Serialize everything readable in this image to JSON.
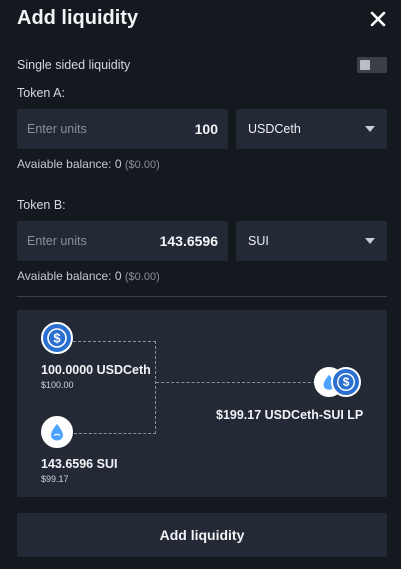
{
  "header": {
    "title": "Add liquidity"
  },
  "single_sided": {
    "label": "Single sided liquidity",
    "enabled": false
  },
  "token_a": {
    "label": "Token A:",
    "placeholder": "Enter units",
    "amount": "100",
    "token": "USDCeth",
    "balance_label": "Avaiable balance: 0",
    "balance_usd": "($0.00)"
  },
  "token_b": {
    "label": "Token B:",
    "placeholder": "Enter units",
    "amount": "143.6596",
    "token": "SUI",
    "balance_label": "Avaiable balance: 0",
    "balance_usd": "($0.00)"
  },
  "preview": {
    "a_amount": "100.0000 USDCeth",
    "a_usd": "$100.00",
    "b_amount": "143.6596 SUI",
    "b_usd": "$99.17",
    "lp_label": "$199.17 USDCeth-SUI LP"
  },
  "submit": {
    "label": "Add liquidity"
  },
  "colors": {
    "background": "#14181f",
    "surface": "#242a35",
    "usdc_blue": "#2b6fd1",
    "sui_blue": "#4da2ff"
  }
}
